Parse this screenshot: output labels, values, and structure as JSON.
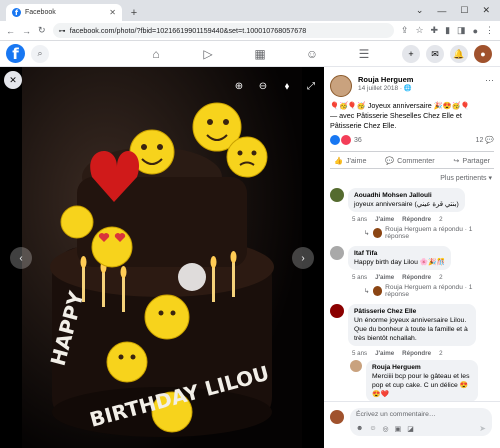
{
  "browser": {
    "tab_title": "Facebook",
    "tab_icon": "f",
    "new_tab": "+",
    "url": "facebook.com/photo/?fbid=10216619901159440&set=t.100010768057678"
  },
  "fb": {
    "logo": "f"
  },
  "post": {
    "author": "Rouja Herguem",
    "date": "14 juillet 2018 · 🌐",
    "caption": "🎈🥳🎈🥳 Joyeux anniversaire 🎉😍🥳🎈",
    "with_text": "— avec Pâtisserie Sheselles Chez Elle et Pâtisserie Chez Elle.",
    "reaction_count": "36",
    "comment_count": "12 💬",
    "like_label": "J'aime",
    "comment_label": "Commenter",
    "share_label": "Partager",
    "sort_label": "Plus pertinents ▾"
  },
  "comments": [
    {
      "author": "Aouadhi Mohsen Jallouli",
      "text": "joyeux anniversaire (بنتي قرة عيني)",
      "age": "5 ans",
      "like": "J'aime",
      "reply": "Répondre",
      "reacts": "2",
      "reply_preview": "Rouja Herguem a répondu · 1 réponse"
    },
    {
      "author": "Itaf Tifa",
      "text": "Happy birth day Lilou 🌸🎉🎊",
      "age": "5 ans",
      "like": "J'aime",
      "reply": "Répondre",
      "reacts": "2",
      "reply_preview": "Rouja Herguem a répondu · 1 réponse"
    },
    {
      "author": "Pâtisserie Chez Elle",
      "text": "Un énorme joyeux anniversaire Lilou. Que du bonheur à toute la famille et à très bientôt nchallah.",
      "age": "5 ans",
      "like": "J'aime",
      "reply": "Répondre",
      "reacts": "2"
    }
  ],
  "nested_reply": {
    "author": "Rouja Herguem",
    "text": "Merciiii bcp pour le gâteau et les pop et cup cake. C un délice 😍😍❤️"
  },
  "composer": {
    "placeholder": "Écrivez un commentaire…"
  },
  "photo": {
    "cake_text_1": "HAPPY",
    "cake_text_2": "BIRTHDAY LILOU"
  },
  "colors": {
    "brand": "#1877f2",
    "viewer_bg": "#000000"
  }
}
